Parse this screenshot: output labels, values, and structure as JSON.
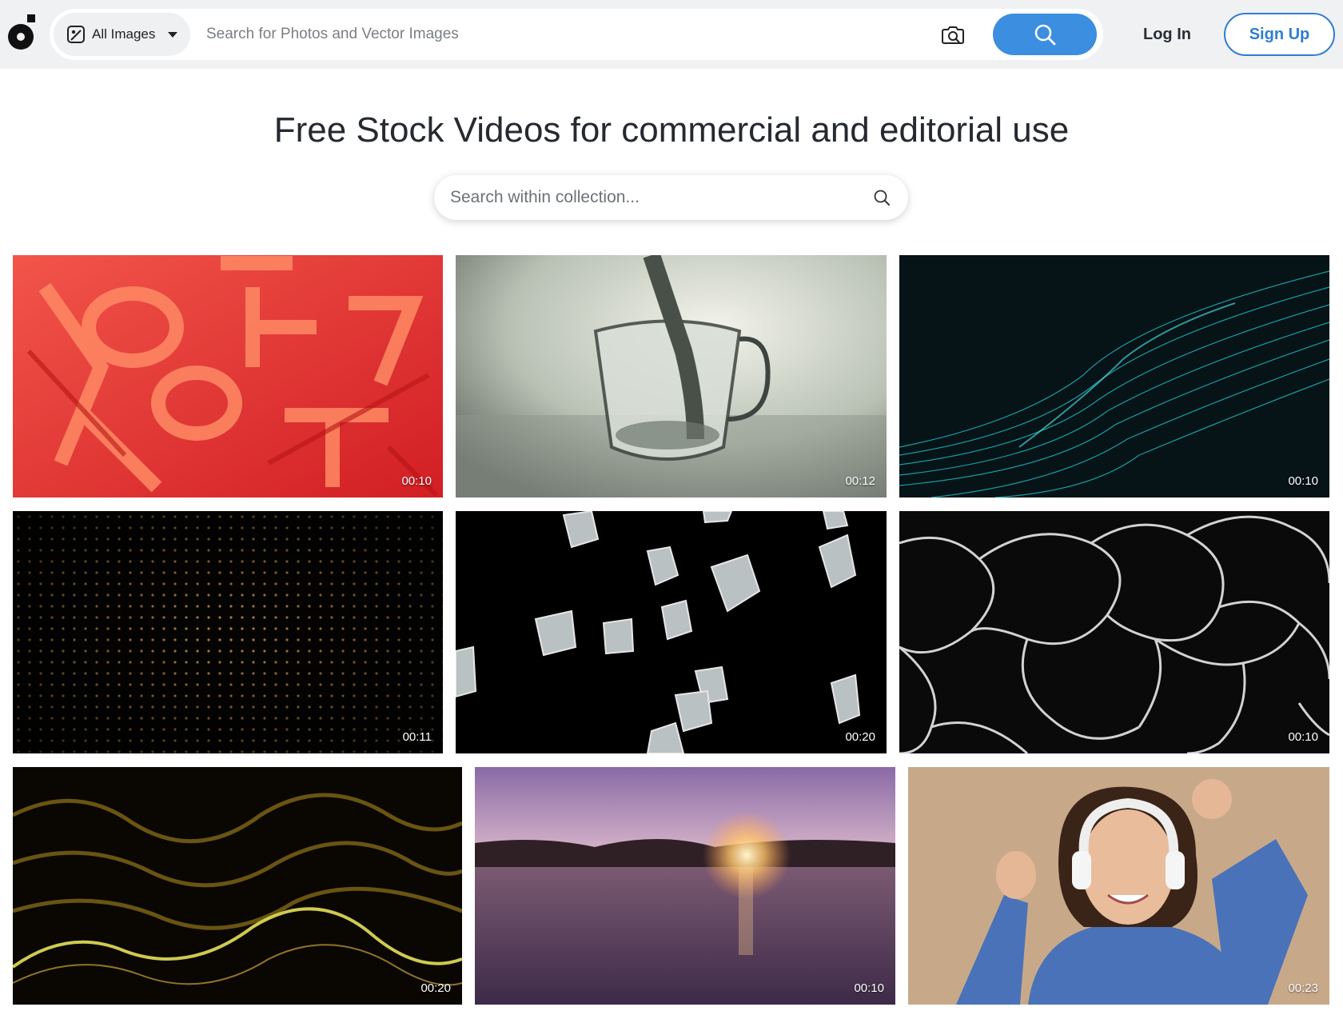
{
  "header": {
    "logo": "stock-site-logo",
    "filter_label": "All Images",
    "search_placeholder": "Search for Photos and Vector Images",
    "login_label": "Log In",
    "signup_label": "Sign Up",
    "accent_color": "#3b8ee0"
  },
  "page": {
    "title": "Free Stock Videos for commercial and editorial use",
    "collection_search_placeholder": "Search within collection..."
  },
  "videos": [
    {
      "duration": "00:10",
      "subject": "red 3D letters"
    },
    {
      "duration": "00:12",
      "subject": "water pouring into glass mug"
    },
    {
      "duration": "00:10",
      "subject": "teal particle wave"
    },
    {
      "duration": "00:11",
      "subject": "golden dot grid"
    },
    {
      "duration": "00:20",
      "subject": "falling ice cubes"
    },
    {
      "duration": "00:10",
      "subject": "white water caustics"
    },
    {
      "duration": "00:20",
      "subject": "golden particle waves"
    },
    {
      "duration": "00:10",
      "subject": "sunset over lake"
    },
    {
      "duration": "00:23",
      "subject": "woman with headphones dancing"
    }
  ]
}
